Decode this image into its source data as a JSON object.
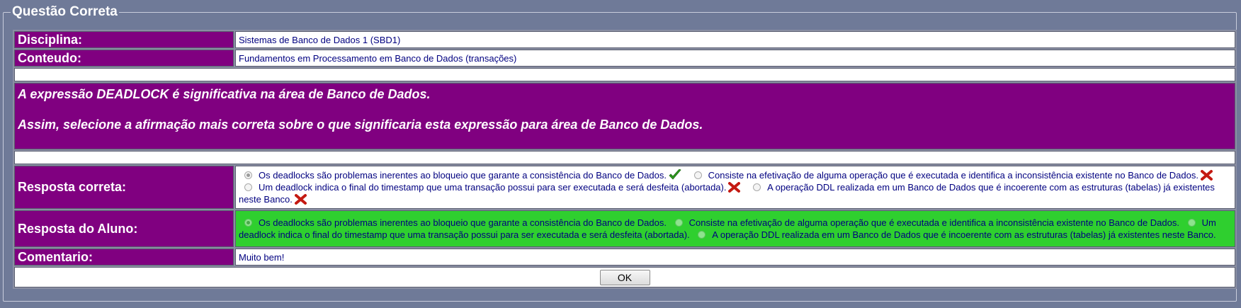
{
  "panel": {
    "title": "Questão Correta"
  },
  "disciplina": {
    "label": "Disciplina:",
    "value": "Sistemas de Banco de Dados 1 (SBD1)"
  },
  "conteudo": {
    "label": "Conteudo:",
    "value": "Fundamentos em Processamento em Banco de Dados (transações)"
  },
  "question": {
    "line1": "A expressão DEADLOCK é significativa na área de Banco de Dados.",
    "line2": "Assim, selecione a afirmação mais correta sobre o que significaria esta expressão para área de Banco de Dados."
  },
  "options": [
    "Os deadlocks são problemas inerentes ao bloqueio que garante a consistência do Banco de Dados.",
    "Consiste na efetivação de alguma operação que é executada e identifica a inconsistência existente no Banco de Dados.",
    "Um deadlock indica o final do timestamp que uma transação possui para ser executada e será desfeita (abortada).",
    "A operação DDL realizada em um Banco de Dados que é incoerente com as estruturas (tabelas) já existentes neste Banco."
  ],
  "resposta_correta": {
    "label": "Resposta correta:",
    "selected_index": 0,
    "marks": [
      "correct-icon",
      "wrong-icon",
      "wrong-icon",
      "wrong-icon"
    ]
  },
  "resposta_aluno": {
    "label": "Resposta do Aluno:",
    "selected_index": 0,
    "background_color": "#2fcf2f"
  },
  "comentario": {
    "label": "Comentario:",
    "value": "Muito bem!"
  },
  "ok_button": {
    "label": "OK"
  },
  "colors": {
    "label_bg": "#800080",
    "value_text": "#000080",
    "page_bg": "#6f7a98"
  }
}
